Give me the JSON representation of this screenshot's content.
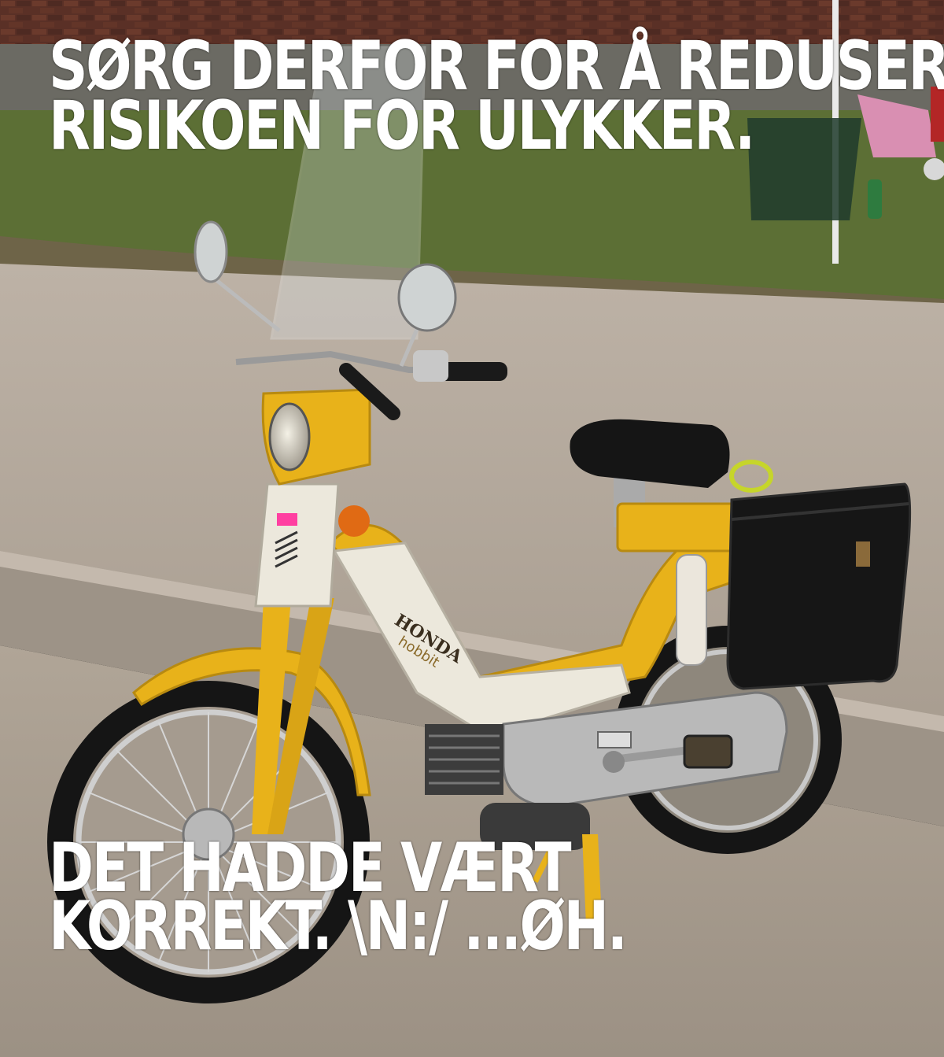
{
  "meme": {
    "top_text": {
      "line1": "SØRG DERFOR FOR Å REDUSERE",
      "line2": "RISIKOEN FOR ULYKKER."
    },
    "bottom_text": {
      "line1": "DET HADDE VÆRT",
      "line2": "KORREKT. \\N:/ ...ØH."
    },
    "photo": {
      "subject": "moped-photo",
      "brand_labels": [
        "HONDA",
        "hobbit"
      ],
      "colors": {
        "moped_yellow": "#e8b21a",
        "panel_white": "#ece8dc",
        "seat_black": "#151515",
        "pavement": "#b7aca0",
        "grass": "#5c6f35",
        "brick_wall": "#5a3026"
      }
    }
  }
}
